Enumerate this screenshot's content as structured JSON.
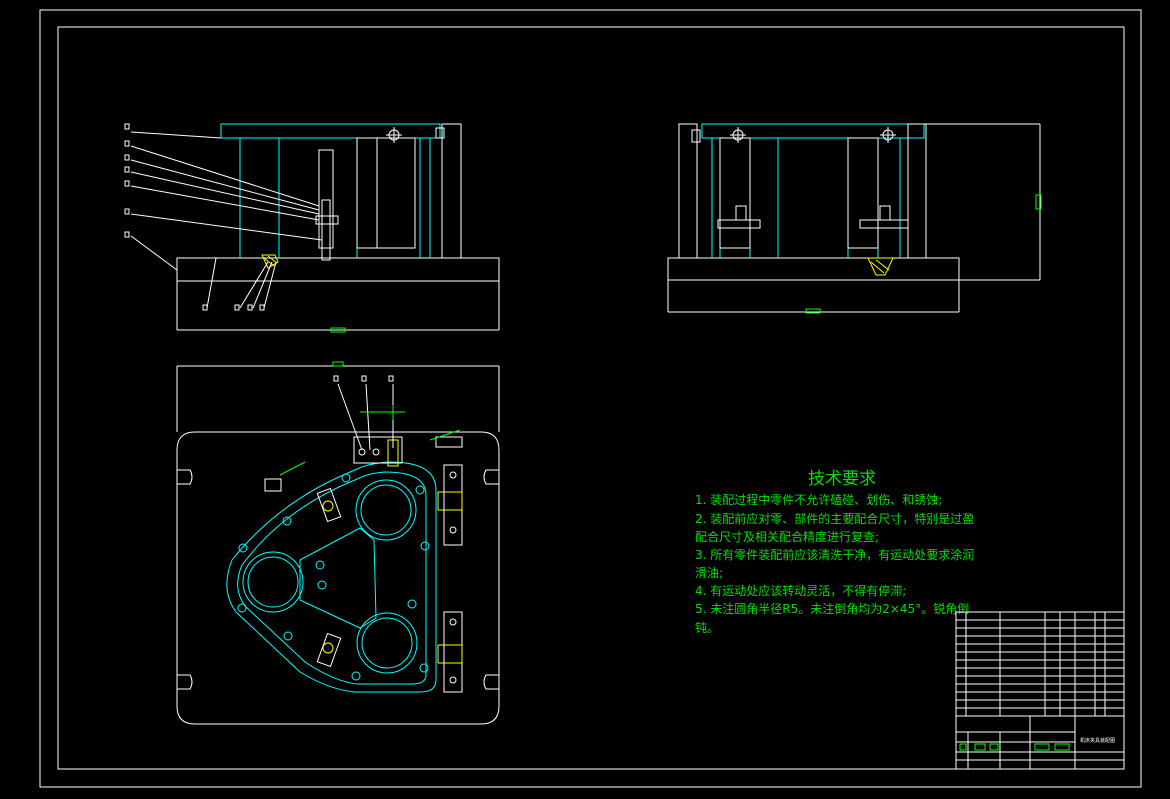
{
  "colors": {
    "background": "#000000",
    "frame": "#ffffff",
    "part_outline": "#00ffff",
    "text": "#00e000",
    "dimension": "#00ff00",
    "section_hatch": "#ffff00"
  },
  "drawing": {
    "tech_requirements": {
      "title": "技术要求",
      "lines": [
        "1. 装配过程中零件不允许磕碰、划伤、和锈蚀;",
        "2. 装配前应对零、部件的主要配合尺寸，特别是过盈",
        "配合尺寸及相关配合精度进行复查;",
        "3. 所有零件装配前应该清洗干净，有运动处要求涂润",
        "滑油;",
        "4. 有运动处应该转动灵活，不得有停滞;",
        "5. 未注圆角半径R5。未注倒角均为2×45°。锐角倒",
        "钝。"
      ]
    },
    "title_block": {
      "drawing_title": "机床夹具装配图"
    }
  }
}
